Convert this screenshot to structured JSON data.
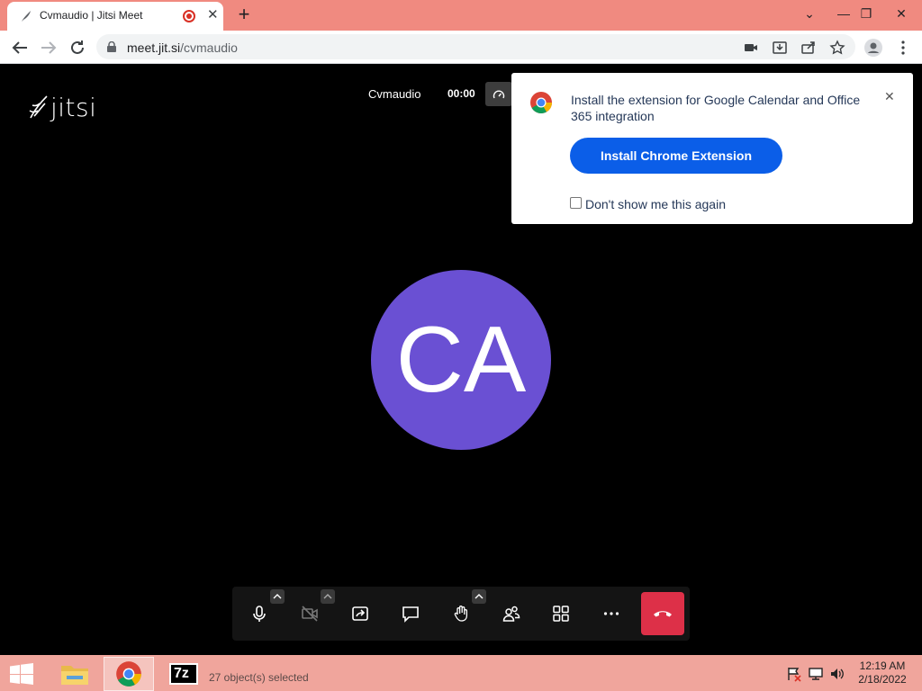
{
  "browser": {
    "tab_title": "Cvmaudio | Jitsi Meet",
    "url_host": "meet.jit.si",
    "url_path": "/cvmaudio"
  },
  "meeting": {
    "logo_text": "jitsi",
    "room_name": "Cvmaudio",
    "timer": "00:00",
    "avatar_initials": "CA",
    "avatar_color": "#6a50d3",
    "hangup_color": "#dd3048"
  },
  "popup": {
    "message": "Install the extension for Google Calendar and Office 365 integration",
    "button_label": "Install Chrome Extension",
    "checkbox_label": "Don't show me this again",
    "button_color": "#0b5ee8"
  },
  "taskbar": {
    "status_text": "27 object(s) selected",
    "time": "12:19 AM",
    "date": "2/18/2022",
    "zip_label": "7z"
  },
  "colors": {
    "tabstrip": "#f08a80",
    "taskbar": "#f0a59c"
  }
}
